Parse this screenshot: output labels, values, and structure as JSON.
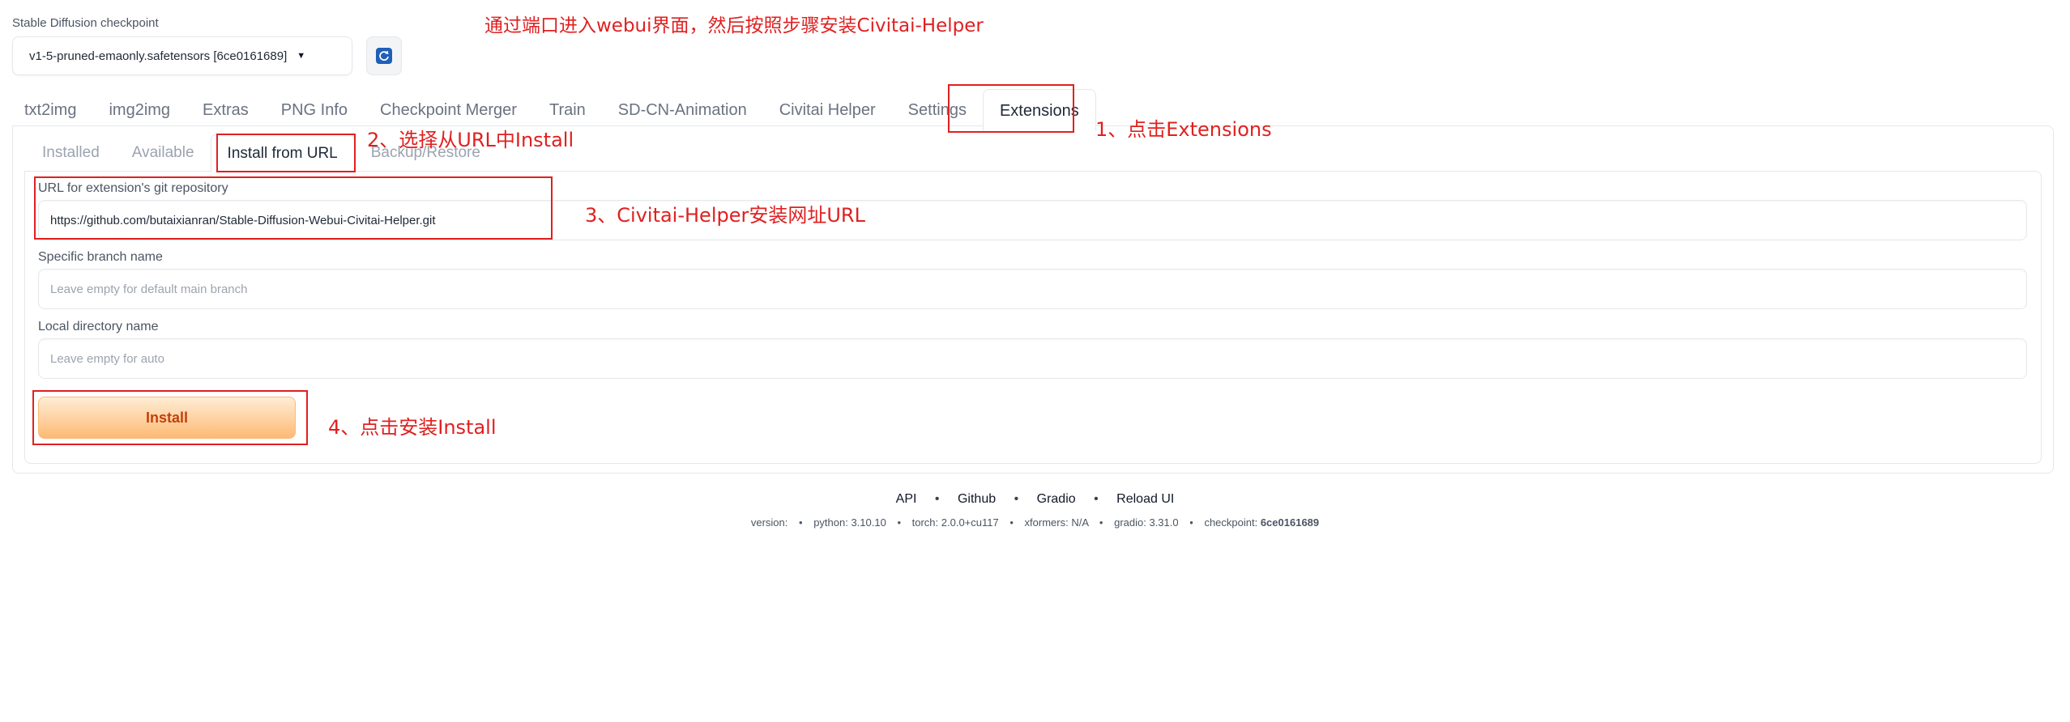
{
  "checkpoint": {
    "label": "Stable Diffusion checkpoint",
    "value": "v1-5-pruned-emaonly.safetensors [6ce0161689]",
    "refresh_icon": "refresh-icon"
  },
  "main_tabs": [
    "txt2img",
    "img2img",
    "Extras",
    "PNG Info",
    "Checkpoint Merger",
    "Train",
    "SD-CN-Animation",
    "Civitai Helper",
    "Settings",
    "Extensions"
  ],
  "sub_tabs": [
    "Installed",
    "Available",
    "Install from URL",
    "Backup/Restore"
  ],
  "form": {
    "url_label": "URL for extension's git repository",
    "url_value": "https://github.com/butaixianran/Stable-Diffusion-Webui-Civitai-Helper.git",
    "branch_label": "Specific branch name",
    "branch_placeholder": "Leave empty for default main branch",
    "dir_label": "Local directory name",
    "dir_placeholder": "Leave empty for auto",
    "install_label": "Install"
  },
  "footer": {
    "links": [
      "API",
      "Github",
      "Gradio",
      "Reload UI"
    ],
    "sep": "•",
    "version": {
      "version_label": "version:",
      "python": "python: 3.10.10",
      "torch": "torch: 2.0.0+cu117",
      "xformers": "xformers: N/A",
      "gradio": "gradio: 3.31.0",
      "checkpoint_label": "checkpoint:",
      "checkpoint_value": "6ce0161689"
    }
  },
  "annotations": {
    "title": "通过端口进入webui界面，然后按照步骤安装Civitai-Helper",
    "step1": "1、点击Extensions",
    "step2": "2、选择从URL中Install",
    "step3": "3、Civitai-Helper安装网址URL",
    "step4": "4、点击安装Install",
    "color": "#e02020"
  }
}
